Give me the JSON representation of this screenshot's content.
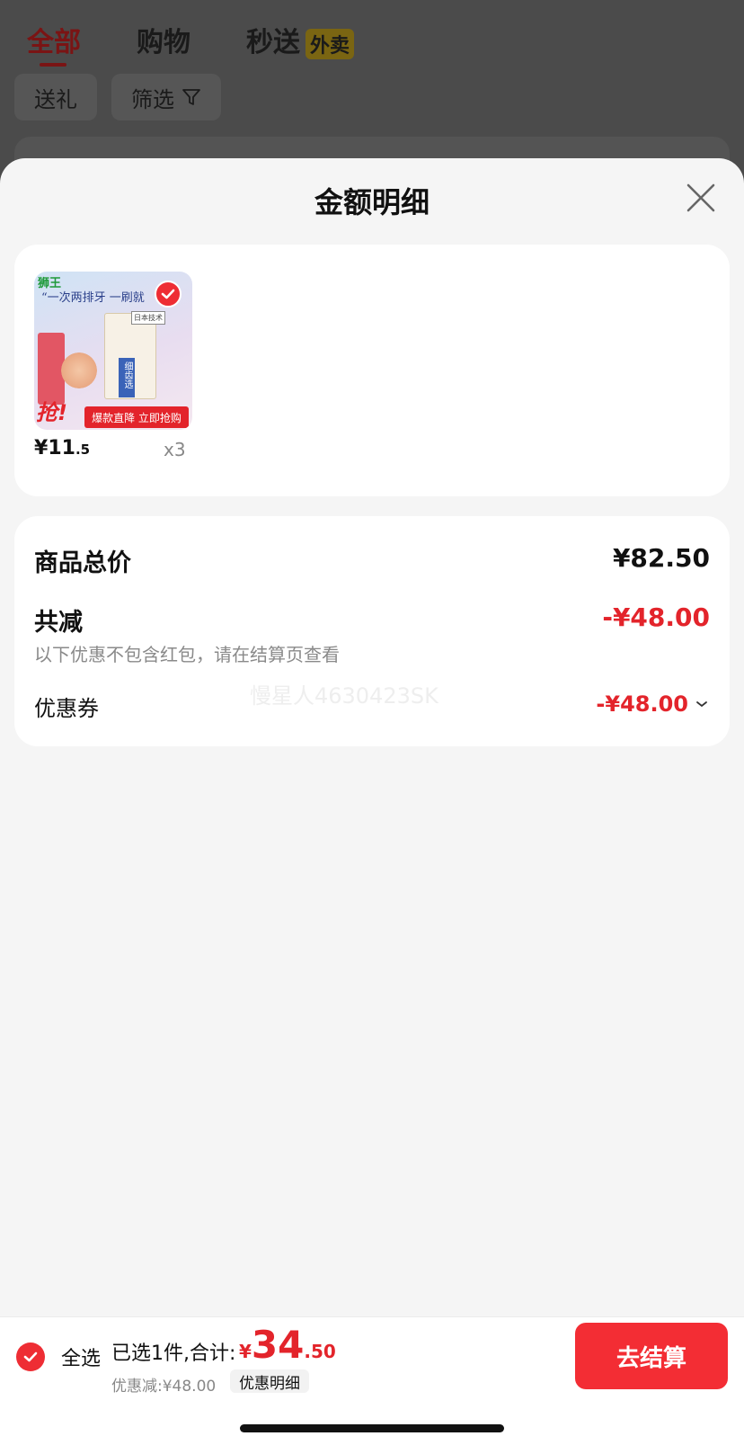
{
  "background": {
    "tabs": [
      {
        "label": "全部"
      },
      {
        "label": "购物"
      },
      {
        "label": "秒送",
        "badge": "外卖"
      }
    ],
    "filters": {
      "gift": "送礼",
      "filter": "筛选"
    }
  },
  "sheet": {
    "title": "金额明细",
    "close_icon": "close-icon"
  },
  "product": {
    "image": {
      "brand": "狮王",
      "slogan": "“一次两排牙 一刷就",
      "pack_label": "日本技术",
      "pack_side": "细齿选",
      "grab": "抢!",
      "banner": "爆款直降 立即抢购"
    },
    "price_currency": "¥",
    "price_int": "11",
    "price_dec": ".5",
    "quantity": "x3",
    "selected": true
  },
  "summary": {
    "total_label": "商品总价",
    "total_value": "¥82.50",
    "reduce_label": "共减",
    "reduce_value": "-¥48.00",
    "note": "以下优惠不包含红包，请在结算页查看",
    "coupon_label": "优惠券",
    "coupon_value": "-¥48.00",
    "watermark": "慢星人4630423SK"
  },
  "checkout": {
    "select_all": "全选",
    "selected_text": "已选1件,合计:",
    "total_currency": "¥",
    "total_int": "34",
    "total_dec": ".50",
    "discount": "优惠减:¥48.00",
    "discount_detail": "优惠明细",
    "submit": "去结算"
  },
  "colors": {
    "accent": "#e3242b",
    "button": "#f32d34",
    "sheet_bg": "#f5f5f5",
    "overlay": "#4a4a4a"
  }
}
